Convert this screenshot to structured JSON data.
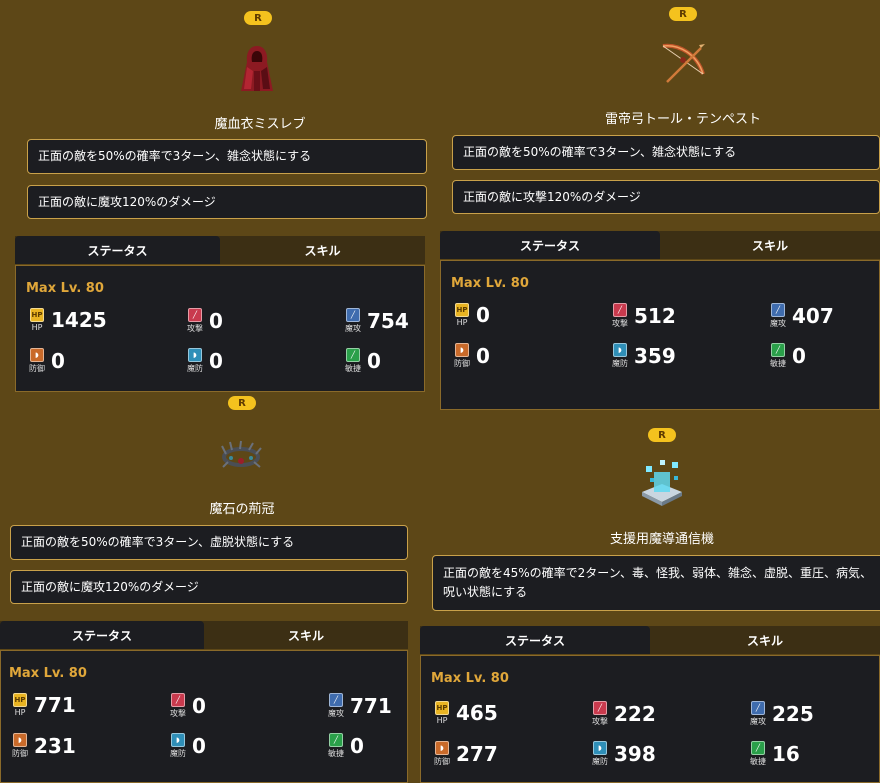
{
  "tabs": {
    "status": "ステータス",
    "skill": "スキル"
  },
  "max_level": "Max Lv. 80",
  "rarity": "R",
  "stat_labels": {
    "hp": "HP",
    "atk": "攻撃",
    "matk": "魔攻",
    "def": "防御",
    "mdef": "魔防",
    "agi": "敏捷"
  },
  "stat_icon_text": {
    "hp": "HP"
  },
  "colors": {
    "background": "#5d4717",
    "panel": "#1c1d21",
    "accent_gold": "#e0a73a",
    "badge": "#f4c21e",
    "hp": "#e9b422",
    "atk": "#c93a4e",
    "matk": "#3f6cae",
    "def": "#c96a2a",
    "mdef": "#2f8fb8",
    "agi": "#2aa04a"
  },
  "items": [
    {
      "name": "魔血衣ミスレブ",
      "sprite": "red-cloak-icon",
      "skills": [
        "正面の敵を50%の確率で3ターン、雑念状態にする",
        "正面の敵に魔攻120%のダメージ"
      ],
      "stats": {
        "hp": "1425",
        "atk": "0",
        "matk": "754",
        "def": "0",
        "mdef": "0",
        "agi": "0"
      }
    },
    {
      "name": "雷帝弓トール・テンペスト",
      "sprite": "bow-icon",
      "skills": [
        "正面の敵を50%の確率で3ターン、雑念状態にする",
        "正面の敵に攻撃120%のダメージ"
      ],
      "stats": {
        "hp": "0",
        "atk": "512",
        "matk": "407",
        "def": "0",
        "mdef": "359",
        "agi": "0"
      }
    },
    {
      "name": "魔石の荊冠",
      "sprite": "thorn-crown-icon",
      "skills": [
        "正面の敵を50%の確率で3ターン、虚脱状態にする",
        "正面の敵に魔攻120%のダメージ"
      ],
      "stats": {
        "hp": "771",
        "atk": "0",
        "matk": "771",
        "def": "231",
        "mdef": "0",
        "agi": "0"
      }
    },
    {
      "name": "支援用魔導通信機",
      "sprite": "communicator-icon",
      "skills": [
        "正面の敵を45%の確率で2ターン、毒、怪我、弱体、雑念、虚脱、重圧、病気、呪い状態にする"
      ],
      "stats": {
        "hp": "465",
        "atk": "222",
        "matk": "225",
        "def": "277",
        "mdef": "398",
        "agi": "16"
      }
    }
  ]
}
